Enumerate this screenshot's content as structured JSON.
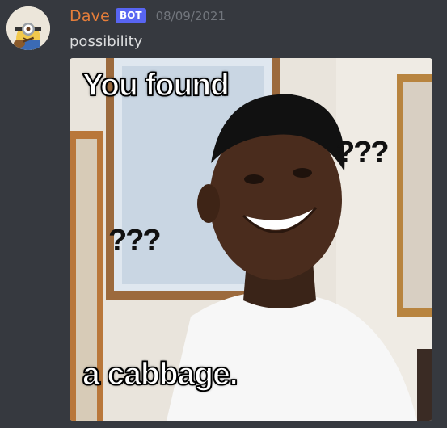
{
  "message": {
    "author": {
      "username": "Dave",
      "badge": "BOT",
      "username_color": "#e67e3a",
      "badge_color": "#5865f2",
      "avatar": "minion-avatar"
    },
    "timestamp": "08/09/2021",
    "content": "possibility",
    "attachment": {
      "type": "meme-image",
      "caption_top": "You found",
      "caption_bottom": "a cabbage.",
      "overlay_marks": [
        "???",
        "???"
      ]
    }
  },
  "theme": {
    "background": "#36393f",
    "text": "#dcddde",
    "timestamp": "#72767d"
  }
}
